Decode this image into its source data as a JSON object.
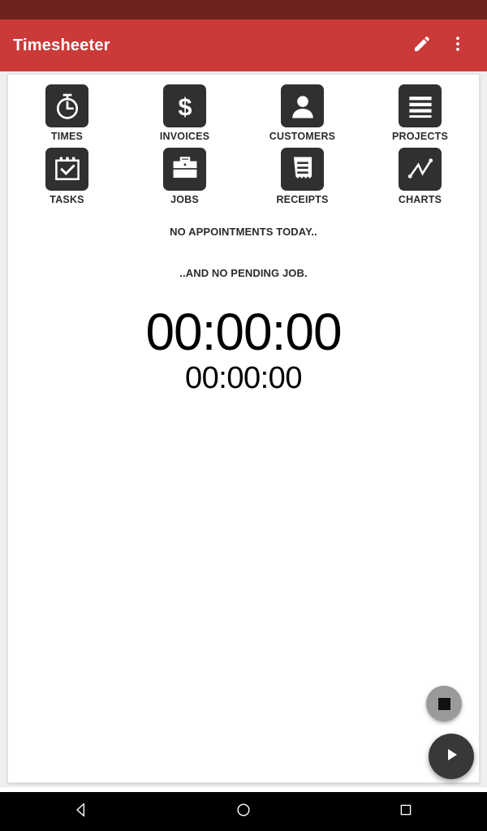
{
  "status_bar": {
    "color": "#6F211E"
  },
  "app_bar": {
    "title": "Timesheeter",
    "background": "#CB3A38",
    "edit_icon": "pencil-icon",
    "overflow_icon": "overflow-menu-icon"
  },
  "grid": {
    "tiles": [
      {
        "label": "TIMES",
        "icon": "stopwatch-icon"
      },
      {
        "label": "INVOICES",
        "icon": "dollar-icon"
      },
      {
        "label": "CUSTOMERS",
        "icon": "person-icon"
      },
      {
        "label": "PROJECTS",
        "icon": "list-lines-icon"
      },
      {
        "label": "TASKS",
        "icon": "calendar-check-icon"
      },
      {
        "label": "JOBS",
        "icon": "briefcase-icon"
      },
      {
        "label": "RECEIPTS",
        "icon": "receipt-icon"
      },
      {
        "label": "CHARTS",
        "icon": "line-chart-icon"
      }
    ],
    "tile_color": "#303030"
  },
  "messages": {
    "appointments": "NO APPOINTMENTS TODAY..",
    "pending_job": "..AND NO PENDING JOB."
  },
  "timers": {
    "primary": "00:00:00",
    "secondary": "00:00:00"
  },
  "fabs": {
    "stop": {
      "name": "stop-button",
      "color": "#9A9A9A",
      "icon": "stop-square-icon"
    },
    "play": {
      "name": "play-button",
      "color": "#383838",
      "icon": "play-triangle-icon"
    }
  },
  "nav_bar": {
    "back": "back-triangle-icon",
    "home": "home-circle-icon",
    "recents": "recents-square-icon"
  }
}
